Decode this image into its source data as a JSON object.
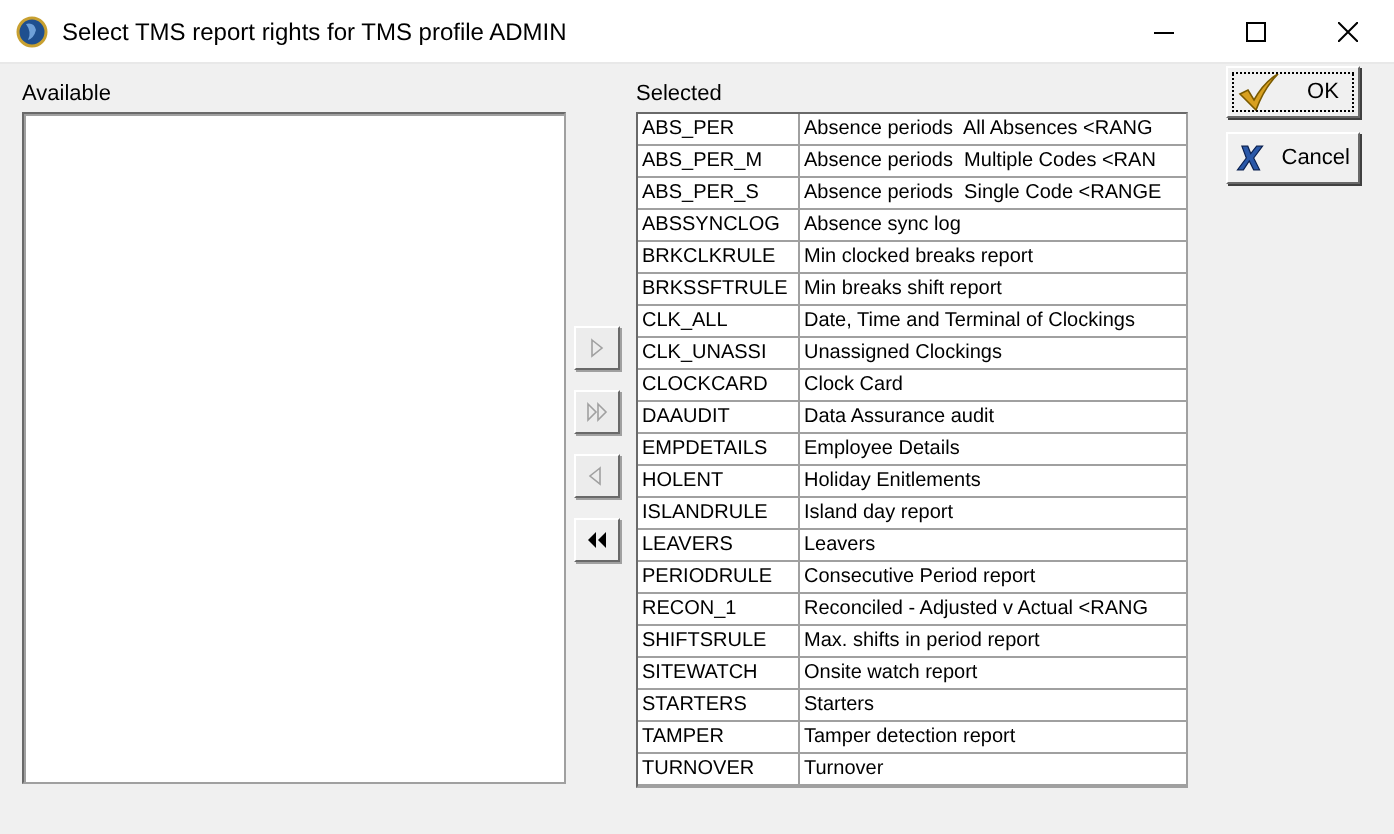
{
  "window": {
    "title": "Select TMS report rights for TMS profile ADMIN"
  },
  "available": {
    "label": "Available"
  },
  "move_buttons": [
    {
      "kind": "move-one-right",
      "disabled": true
    },
    {
      "kind": "move-all-right",
      "disabled": true
    },
    {
      "kind": "move-one-left",
      "disabled": true
    },
    {
      "kind": "move-all-left",
      "disabled": false
    }
  ],
  "selected": {
    "label": "Selected",
    "rows": [
      {
        "code": "ABS_PER",
        "description": "Absence periods  All Absences <RANG"
      },
      {
        "code": "ABS_PER_M",
        "description": "Absence periods  Multiple Codes <RAN"
      },
      {
        "code": "ABS_PER_S",
        "description": "Absence periods  Single Code <RANGE"
      },
      {
        "code": "ABSSYNCLOG",
        "description": "Absence sync log"
      },
      {
        "code": "BRKCLKRULE",
        "description": "Min clocked breaks report"
      },
      {
        "code": "BRKSSFTRULE",
        "description": "Min breaks shift report"
      },
      {
        "code": "CLK_ALL",
        "description": "Date, Time and Terminal of Clockings"
      },
      {
        "code": "CLK_UNASSI",
        "description": "Unassigned Clockings"
      },
      {
        "code": "CLOCKCARD",
        "description": "Clock Card"
      },
      {
        "code": "DAAUDIT",
        "description": "Data Assurance audit"
      },
      {
        "code": "EMPDETAILS",
        "description": "Employee Details"
      },
      {
        "code": "HOLENT",
        "description": "Holiday Enitlements"
      },
      {
        "code": "ISLANDRULE",
        "description": "Island day report"
      },
      {
        "code": "LEAVERS",
        "description": "Leavers"
      },
      {
        "code": "PERIODRULE",
        "description": "Consecutive Period report"
      },
      {
        "code": "RECON_1",
        "description": "Reconciled - Adjusted v Actual <RANG"
      },
      {
        "code": "SHIFTSRULE",
        "description": "Max. shifts in period report"
      },
      {
        "code": "SITEWATCH",
        "description": "Onsite watch report"
      },
      {
        "code": "STARTERS",
        "description": "Starters"
      },
      {
        "code": "TAMPER",
        "description": "Tamper detection report"
      },
      {
        "code": "TURNOVER",
        "description": "Turnover"
      }
    ]
  },
  "buttons": [
    {
      "kind": "ok",
      "label": "OK"
    },
    {
      "kind": "cancel",
      "label": "Cancel"
    }
  ]
}
